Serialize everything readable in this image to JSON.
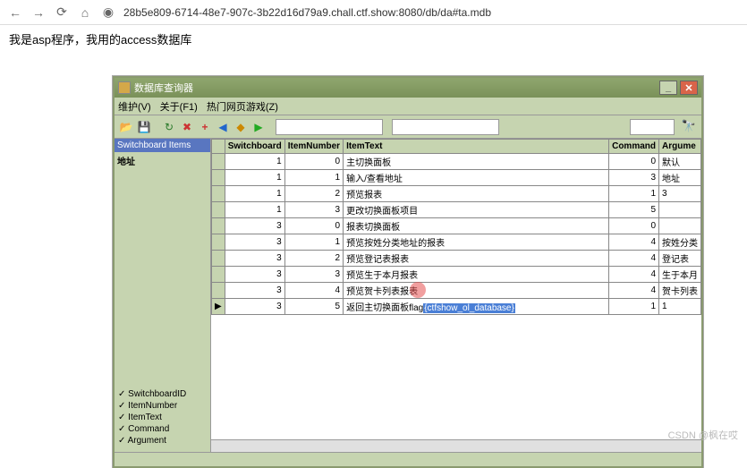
{
  "browser": {
    "url": "28b5e809-6714-48e7-907c-3b22d16d79a9.chall.ctf.show:8080/db/da#ta.mdb"
  },
  "page_text": "我是asp程序，我用的access数据库",
  "window": {
    "title": "数据库查询器",
    "menus": {
      "maint": "维护(V)",
      "about": "关于(F1)",
      "games": "热门网页游戏(Z)"
    }
  },
  "sidebar": {
    "top": "Switchboard Items",
    "sub": "地址",
    "fields": [
      "SwitchboardID",
      "ItemNumber",
      "ItemText",
      "Command",
      "Argument"
    ]
  },
  "table": {
    "headers": [
      "Switchboard",
      "ItemNumber",
      "ItemText",
      "Command",
      "Argume"
    ],
    "rows": [
      {
        "sw": "1",
        "in": "0",
        "tx": "主切换面板",
        "cmd": "0",
        "arg": "默认"
      },
      {
        "sw": "1",
        "in": "1",
        "tx": "输入/查看地址",
        "cmd": "3",
        "arg": "地址"
      },
      {
        "sw": "1",
        "in": "2",
        "tx": "预览报表",
        "cmd": "1",
        "arg": "3"
      },
      {
        "sw": "1",
        "in": "3",
        "tx": "更改切换面板项目",
        "cmd": "5",
        "arg": ""
      },
      {
        "sw": "3",
        "in": "0",
        "tx": "报表切换面板",
        "cmd": "0",
        "arg": ""
      },
      {
        "sw": "3",
        "in": "1",
        "tx": "预览按姓分类地址的报表",
        "cmd": "4",
        "arg": "按姓分类"
      },
      {
        "sw": "3",
        "in": "2",
        "tx": "预览登记表报表",
        "cmd": "4",
        "arg": "登记表"
      },
      {
        "sw": "3",
        "in": "3",
        "tx": "预览生于本月报表",
        "cmd": "4",
        "arg": "生于本月"
      },
      {
        "sw": "3",
        "in": "4",
        "tx": "预览贺卡列表报表",
        "cmd": "4",
        "arg": "贺卡列表"
      },
      {
        "sw": "3",
        "in": "5",
        "tx_pre": "返回主切换面板flag",
        "tx_sel": "{ctfshow_ol_database}",
        "cmd": "1",
        "arg": "1"
      }
    ]
  },
  "watermark": "CSDN @枫在哎"
}
